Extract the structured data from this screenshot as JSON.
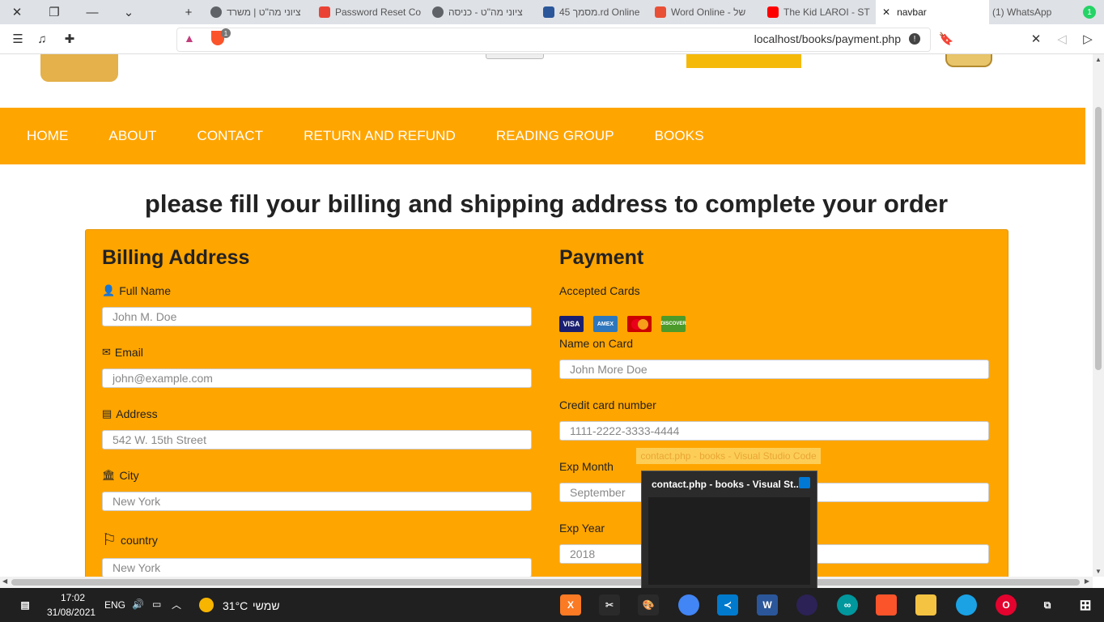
{
  "browser": {
    "tabs": [
      {
        "label": "ציוני מה\"ט | משרד",
        "color": "#5f6368"
      },
      {
        "label": "Password Reset Co",
        "color": "#ea4335"
      },
      {
        "label": "ציוני מה\"ט - כניסה",
        "color": "#5f6368"
      },
      {
        "label": "מסמך 45.rd Online",
        "color": "#2b579a"
      },
      {
        "label": "Word Online - של",
        "color": "#e94f35"
      },
      {
        "label": "The Kid LAROI - ST",
        "color": "#ff0000"
      },
      {
        "label": "navbar",
        "color": "#fff"
      },
      {
        "label": "(1) WhatsApp",
        "color": "#25d366"
      }
    ],
    "url": "localhost/books/payment.php",
    "whatsapp_badge": "1",
    "brave_badge": "1"
  },
  "nav": {
    "items": [
      "HOME",
      "ABOUT",
      "CONTACT",
      "RETURN AND REFUND",
      "READING GROUP",
      "BOOKS"
    ]
  },
  "page": {
    "heading": "please fill your billing and shipping address to complete your order"
  },
  "billing": {
    "title": "Billing Address",
    "fullname": {
      "label": "Full Name",
      "placeholder": "John M. Doe"
    },
    "email": {
      "label": "Email",
      "placeholder": "john@example.com"
    },
    "address": {
      "label": "Address",
      "placeholder": "542 W. 15th Street"
    },
    "city": {
      "label": "City",
      "placeholder": "New York"
    },
    "country": {
      "label": "country",
      "placeholder": "New York"
    }
  },
  "payment": {
    "title": "Payment",
    "accepted_cards_label": "Accepted Cards",
    "cards": [
      "VISA",
      "AMEX",
      "MC",
      "DISCOVER"
    ],
    "name_on_card": {
      "label": "Name on Card",
      "placeholder": "John More Doe"
    },
    "card_number": {
      "label": "Credit card number",
      "placeholder": "1111-2222-3333-4444"
    },
    "exp_month": {
      "label": "Exp Month",
      "placeholder": "September"
    },
    "exp_year": {
      "label": "Exp Year",
      "placeholder": "2018"
    }
  },
  "popups": {
    "tooltip": "contact.php - books - Visual Studio Code",
    "preview_title": "contact.php - books - Visual St..."
  },
  "taskbar": {
    "time": "17:02",
    "date": "31/08/2021",
    "lang": "ENG",
    "temperature": "31°C",
    "weather_text": "שמשי"
  }
}
